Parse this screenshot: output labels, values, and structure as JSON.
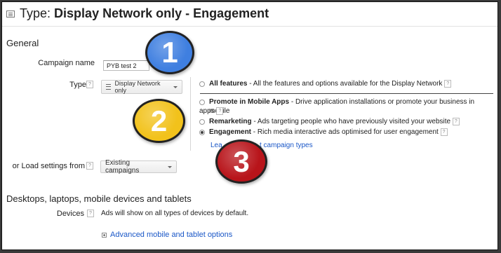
{
  "header": {
    "title_prefix": "Type:",
    "title_value": "Display Network only - Engagement"
  },
  "general": {
    "section_title": "General",
    "campaign_name_label": "Campaign name",
    "campaign_name_value": "PYB test 2",
    "type_label": "Type",
    "type_button": "Display Network only",
    "load_label": "or Load settings from",
    "load_button": "Existing campaigns"
  },
  "type_options": [
    {
      "title": "All features",
      "desc": " - All the features and options available for the Display Network",
      "selected": false
    },
    {
      "title": "Promote in Mobile Apps",
      "desc": " - Drive application installations or promote your business in mobile",
      "desc_cont": "apps",
      "selected": false
    },
    {
      "title": "Remarketing",
      "desc": " - Ads targeting people who have previously visited your website",
      "selected": false
    },
    {
      "title": "Engagement",
      "desc": " - Rich media interactive ads optimised for user engagement",
      "selected": true
    }
  ],
  "learn_more": {
    "start": "Lea",
    "end": "t campaign types"
  },
  "devices_section": {
    "title": "Desktops, laptops, mobile devices and tablets",
    "devices_label": "Devices",
    "devices_text": "Ads will show on all types of devices by default.",
    "advanced_link": "Advanced mobile and tablet options"
  },
  "help_glyph": "?",
  "badges": [
    {
      "number": "1",
      "color": "#3f7fe0"
    },
    {
      "number": "2",
      "color": "#f2c21b"
    },
    {
      "number": "3",
      "color": "#b8141a"
    }
  ]
}
